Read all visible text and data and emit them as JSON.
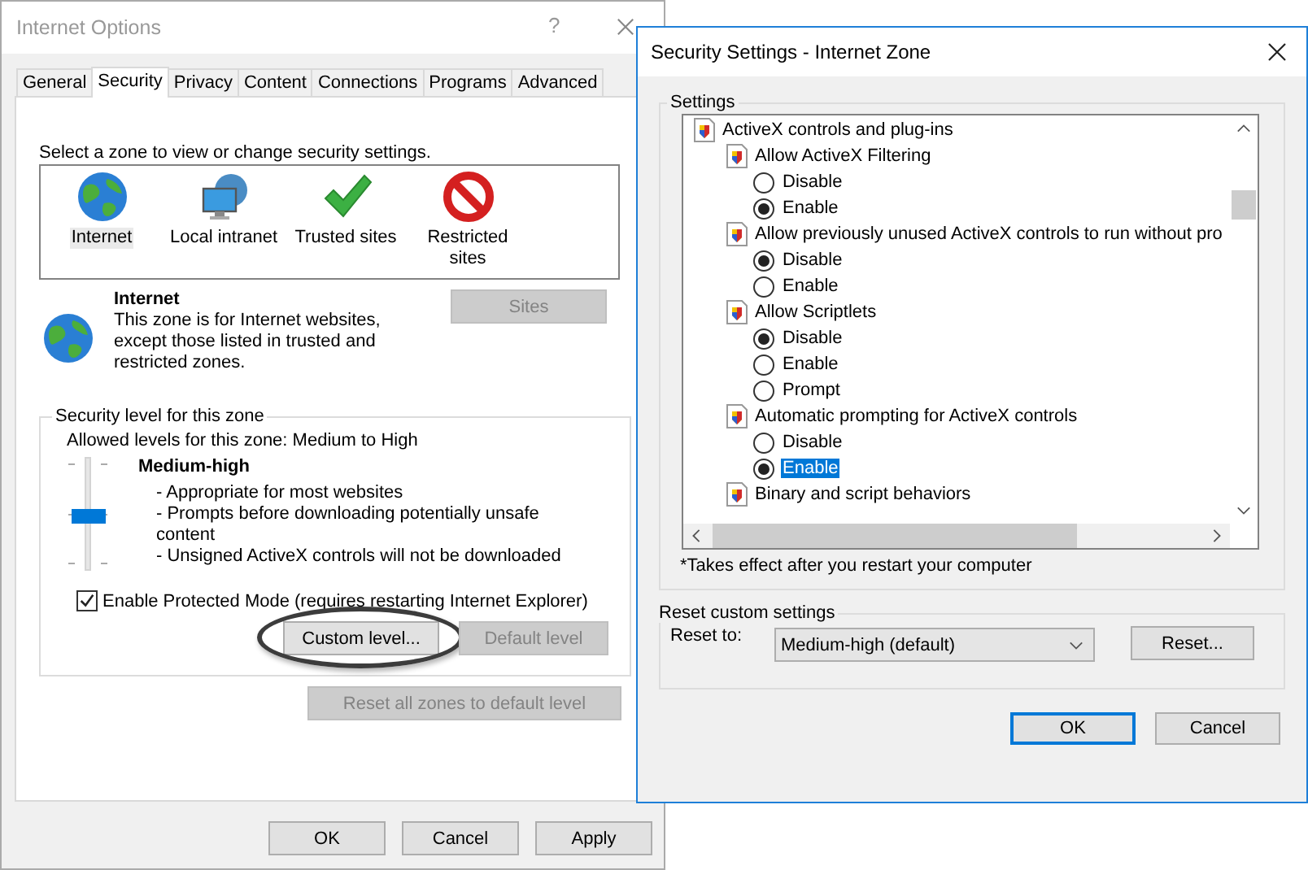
{
  "internet_options": {
    "title": "Internet Options",
    "help_button": "?",
    "tabs": [
      {
        "label": "General",
        "selected": false
      },
      {
        "label": "Security",
        "selected": true
      },
      {
        "label": "Privacy",
        "selected": false
      },
      {
        "label": "Content",
        "selected": false
      },
      {
        "label": "Connections",
        "selected": false
      },
      {
        "label": "Programs",
        "selected": false
      },
      {
        "label": "Advanced",
        "selected": false
      }
    ],
    "zone_prompt": "Select a zone to view or change security settings.",
    "zones": [
      {
        "label": "Internet",
        "selected": true
      },
      {
        "label": "Local intranet",
        "selected": false
      },
      {
        "label": "Trusted sites",
        "selected": false
      },
      {
        "label": "Restricted sites",
        "selected": false
      }
    ],
    "zone_info": {
      "name": "Internet",
      "description": "This zone is for Internet websites, except those listed in trusted and restricted zones."
    },
    "sites_button": {
      "label": "Sites",
      "disabled": true
    },
    "security_level": {
      "legend": "Security level for this zone",
      "allowed": "Allowed levels for this zone: Medium to High",
      "slider": {
        "level": 0.5
      },
      "level_name": "Medium-high",
      "bullets": [
        "- Appropriate for most websites",
        "- Prompts before downloading potentially unsafe content",
        "- Unsigned ActiveX controls will not be downloaded"
      ],
      "protected_mode": {
        "label": "Enable Protected Mode (requires restarting Internet Explorer)",
        "checked": true
      },
      "buttons": [
        {
          "label": "Custom level...",
          "disabled": false,
          "circled": true
        },
        {
          "label": "Default level",
          "disabled": true,
          "circled": false
        }
      ]
    },
    "reset_all_button": {
      "label": "Reset all zones to default level",
      "disabled": true
    },
    "buttons": [
      {
        "label": "OK",
        "disabled": false
      },
      {
        "label": "Cancel",
        "disabled": false
      },
      {
        "label": "Apply",
        "disabled": false
      }
    ]
  },
  "security_settings": {
    "title": "Security Settings - Internet Zone",
    "legend": "Settings",
    "tree": [
      {
        "kind": "category",
        "label": "ActiveX controls and plug-ins",
        "children": [
          {
            "kind": "setting",
            "label": "Allow ActiveX Filtering",
            "children": [
              {
                "kind": "radio",
                "label": "Disable",
                "selected": false,
                "highlighted": false
              },
              {
                "kind": "radio",
                "label": "Enable",
                "selected": true,
                "highlighted": false
              }
            ]
          },
          {
            "kind": "setting",
            "label": "Allow previously unused ActiveX controls to run without pro",
            "children": [
              {
                "kind": "radio",
                "label": "Disable",
                "selected": true,
                "highlighted": false
              },
              {
                "kind": "radio",
                "label": "Enable",
                "selected": false,
                "highlighted": false
              }
            ]
          },
          {
            "kind": "setting",
            "label": "Allow Scriptlets",
            "children": [
              {
                "kind": "radio",
                "label": "Disable",
                "selected": true,
                "highlighted": false
              },
              {
                "kind": "radio",
                "label": "Enable",
                "selected": false,
                "highlighted": false
              },
              {
                "kind": "radio",
                "label": "Prompt",
                "selected": false,
                "highlighted": false
              }
            ]
          },
          {
            "kind": "setting",
            "label": "Automatic prompting for ActiveX controls",
            "children": [
              {
                "kind": "radio",
                "label": "Disable",
                "selected": false,
                "highlighted": false
              },
              {
                "kind": "radio",
                "label": "Enable",
                "selected": true,
                "highlighted": true
              }
            ]
          },
          {
            "kind": "setting",
            "label": "Binary and script behaviors"
          }
        ]
      }
    ],
    "note": "*Takes effect after you restart your computer",
    "reset": {
      "legend": "Reset custom settings",
      "label": "Reset to:",
      "value": "Medium-high (default)",
      "button": "Reset..."
    },
    "buttons": [
      {
        "label": "OK",
        "default": true
      },
      {
        "label": "Cancel",
        "default": false
      }
    ]
  }
}
